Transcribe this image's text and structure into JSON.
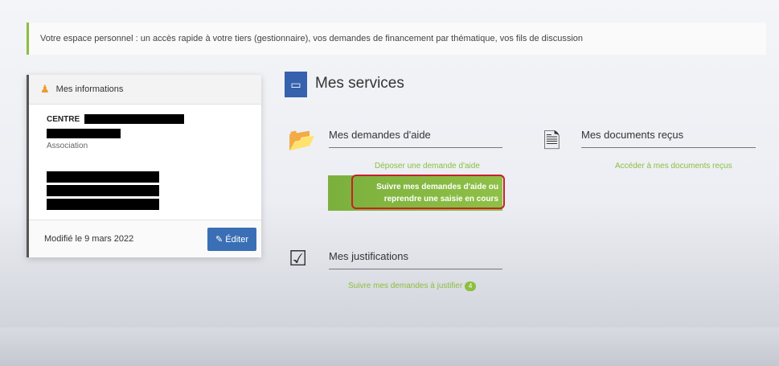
{
  "banner": {
    "text": "Votre espace personnel : un accès rapide à votre tiers (gestionnaire), vos demandes de financement par thématique, vos fils de discussion"
  },
  "info_panel": {
    "title": "Mes informations",
    "org_prefix": "CENTRE",
    "org_type": "Association",
    "modified": "Modifié le 9 mars 2022",
    "edit_label": "Éditer"
  },
  "services": {
    "title": "Mes services",
    "aid": {
      "title": "Mes demandes d'aide",
      "deposit_link": "Déposer une demande d'aide",
      "follow_line1": "Suivre mes demandes d'aide ou",
      "follow_line2": "reprendre une saisie en cours"
    },
    "docs": {
      "title": "Mes documents reçus",
      "link": "Accéder à mes documents reçus"
    },
    "justifs": {
      "title": "Mes justifications",
      "link": "Suivre mes demandes à justifier",
      "badge": "4"
    }
  },
  "colors": {
    "accent_green": "#8cbf3f",
    "accent_blue": "#3561ad",
    "highlight_red": "#c8202a"
  }
}
